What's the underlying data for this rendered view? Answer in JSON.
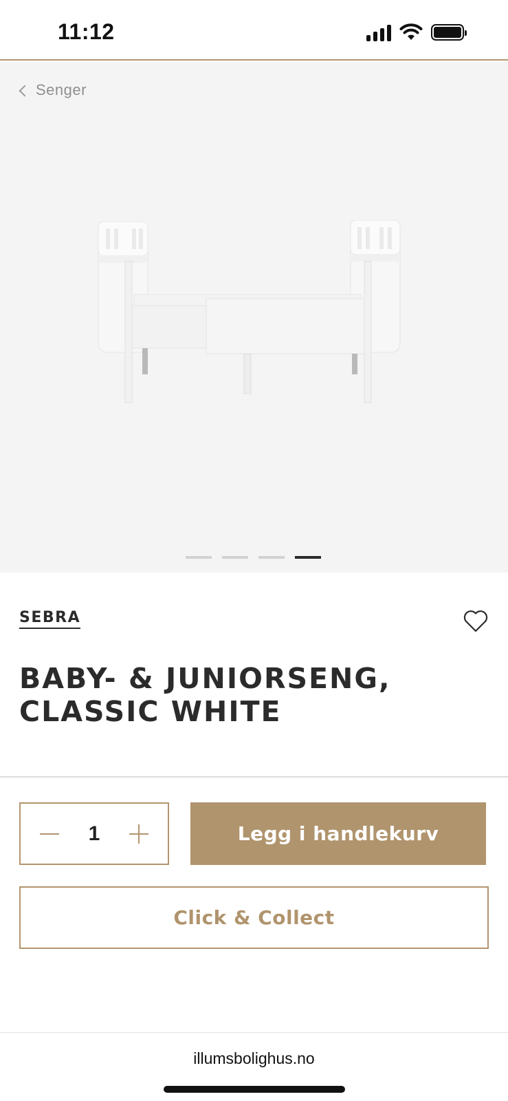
{
  "status_bar": {
    "time": "11:12",
    "icons": [
      "cellular-signal-icon",
      "wifi-icon",
      "battery-icon"
    ]
  },
  "breadcrumb": {
    "back_label": "Senger"
  },
  "gallery": {
    "image_count": 4,
    "active_index": 3
  },
  "product": {
    "brand": "SEBRA",
    "title_line1": "BABY- & JUNIORSENG,",
    "title_line2": "CLASSIC WHITE"
  },
  "purchase": {
    "quantity": "1",
    "add_to_cart_label": "Legg i handlekurv",
    "click_collect_label": "Click & Collect"
  },
  "browser": {
    "url": "illumsbolighus.no"
  },
  "colors": {
    "accent": "#b0946d",
    "text": "#2b2b2b",
    "hero_bg": "#f4f4f4"
  }
}
